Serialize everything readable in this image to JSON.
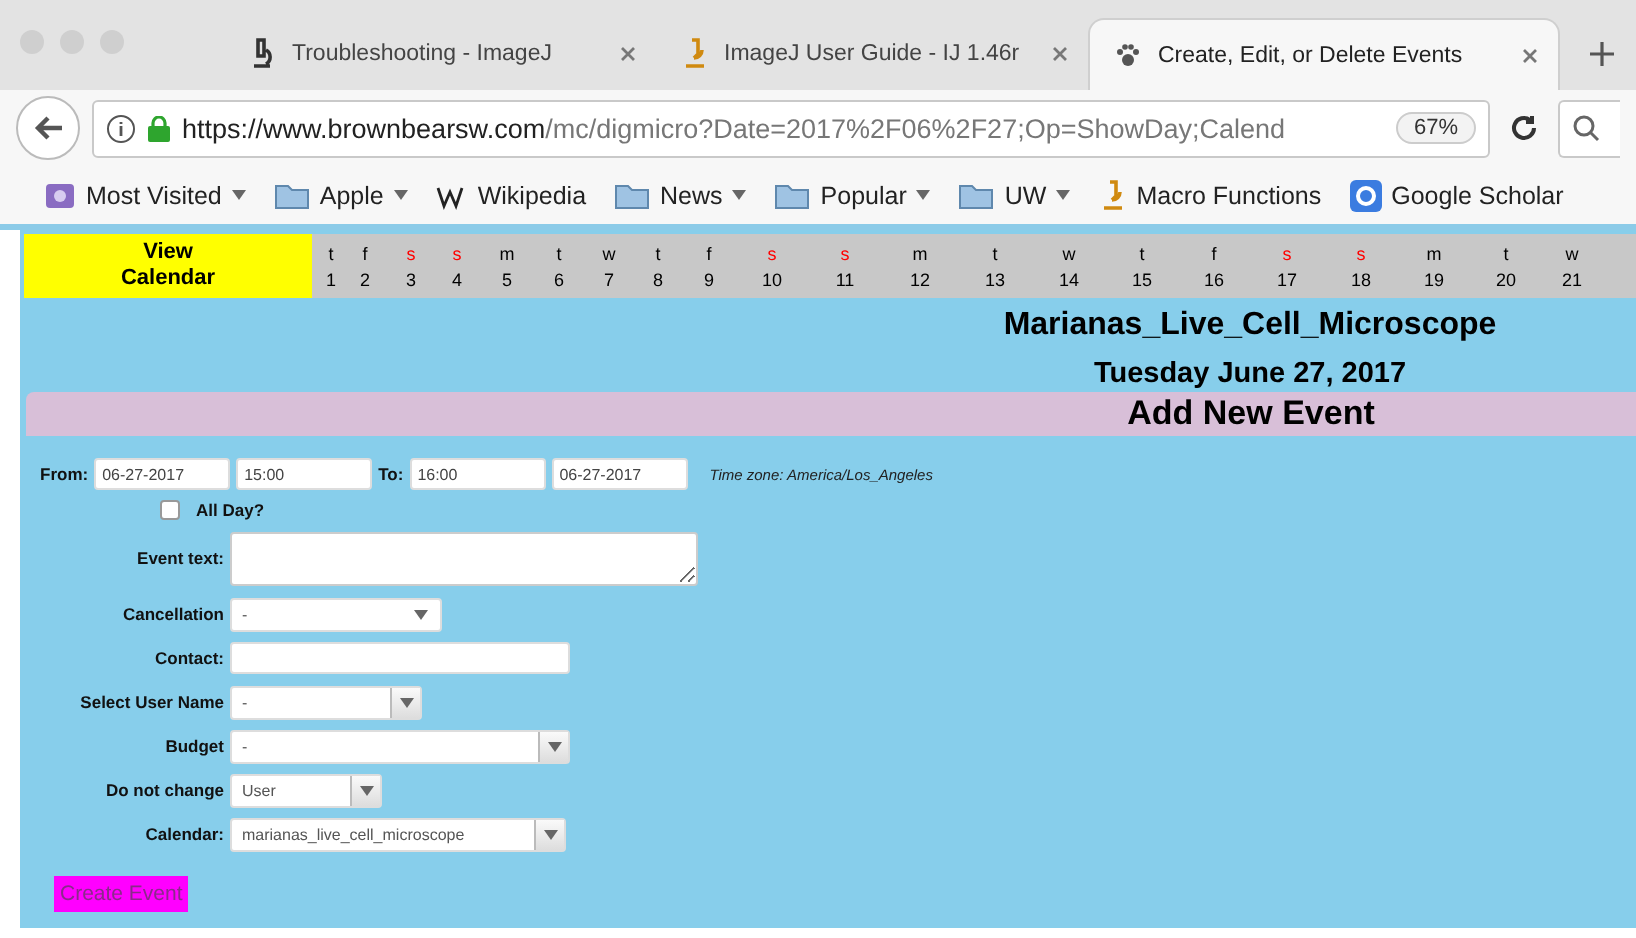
{
  "browser": {
    "tabs": [
      {
        "title": "Troubleshooting - ImageJ",
        "selected": false
      },
      {
        "title": "ImageJ User Guide - IJ 1.46r",
        "selected": false
      },
      {
        "title": "Create, Edit, or Delete Events",
        "selected": true
      }
    ],
    "url_host": "https://www.brownbearsw.com",
    "url_path": "/mc/digmicro?Date=2017%2F06%2F27;Op=ShowDay;Calend",
    "zoom": "67%",
    "bookmarks": [
      {
        "label": "Most Visited",
        "dropdown": true
      },
      {
        "label": "Apple",
        "dropdown": true
      },
      {
        "label": "Wikipedia",
        "dropdown": false
      },
      {
        "label": "News",
        "dropdown": true
      },
      {
        "label": "Popular",
        "dropdown": true
      },
      {
        "label": "UW",
        "dropdown": true
      },
      {
        "label": "Macro Functions",
        "dropdown": false
      },
      {
        "label": "Google Scholar",
        "dropdown": false
      }
    ]
  },
  "calendar": {
    "view_button": "View Calendar",
    "days": [
      {
        "letter": "t",
        "number": "1",
        "weekend": false
      },
      {
        "letter": "f",
        "number": "2",
        "weekend": false
      },
      {
        "letter": "s",
        "number": "3",
        "weekend": true
      },
      {
        "letter": "s",
        "number": "4",
        "weekend": true
      },
      {
        "letter": "m",
        "number": "5",
        "weekend": false
      },
      {
        "letter": "t",
        "number": "6",
        "weekend": false
      },
      {
        "letter": "w",
        "number": "7",
        "weekend": false
      },
      {
        "letter": "t",
        "number": "8",
        "weekend": false
      },
      {
        "letter": "f",
        "number": "9",
        "weekend": false
      },
      {
        "letter": "s",
        "number": "10",
        "weekend": true
      },
      {
        "letter": "s",
        "number": "11",
        "weekend": true
      },
      {
        "letter": "m",
        "number": "12",
        "weekend": false
      },
      {
        "letter": "t",
        "number": "13",
        "weekend": false
      },
      {
        "letter": "w",
        "number": "14",
        "weekend": false
      },
      {
        "letter": "t",
        "number": "15",
        "weekend": false
      },
      {
        "letter": "f",
        "number": "16",
        "weekend": false
      },
      {
        "letter": "s",
        "number": "17",
        "weekend": true
      },
      {
        "letter": "s",
        "number": "18",
        "weekend": true
      },
      {
        "letter": "m",
        "number": "19",
        "weekend": false
      },
      {
        "letter": "t",
        "number": "20",
        "weekend": false
      },
      {
        "letter": "w",
        "number": "21",
        "weekend": false
      }
    ]
  },
  "header": {
    "resource": "Marianas_Live_Cell_Microscope",
    "date": "Tuesday June 27, 2017",
    "section": "Add New Event"
  },
  "form": {
    "from_label": "From:",
    "from_date": "06-27-2017",
    "from_time": "15:00",
    "to_label": "To:",
    "to_time": "16:00",
    "to_date": "06-27-2017",
    "timezone": "Time zone: America/Los_Angeles",
    "all_day": {
      "label": "All Day?",
      "checked": false
    },
    "fields": [
      {
        "label": "Event text:",
        "kind": "textarea"
      },
      {
        "label": "Cancellation",
        "kind": "dropdown",
        "value": "-"
      },
      {
        "label": "Contact:",
        "kind": "text"
      },
      {
        "label": "Select User Name",
        "kind": "select",
        "value": "-"
      },
      {
        "label": "Budget",
        "kind": "select",
        "value": "-"
      },
      {
        "label": "Do not change",
        "kind": "select",
        "value": "User"
      },
      {
        "label": "Calendar:",
        "kind": "select",
        "value": "marianas_live_cell_microscope"
      }
    ],
    "submit": "Create Event"
  }
}
